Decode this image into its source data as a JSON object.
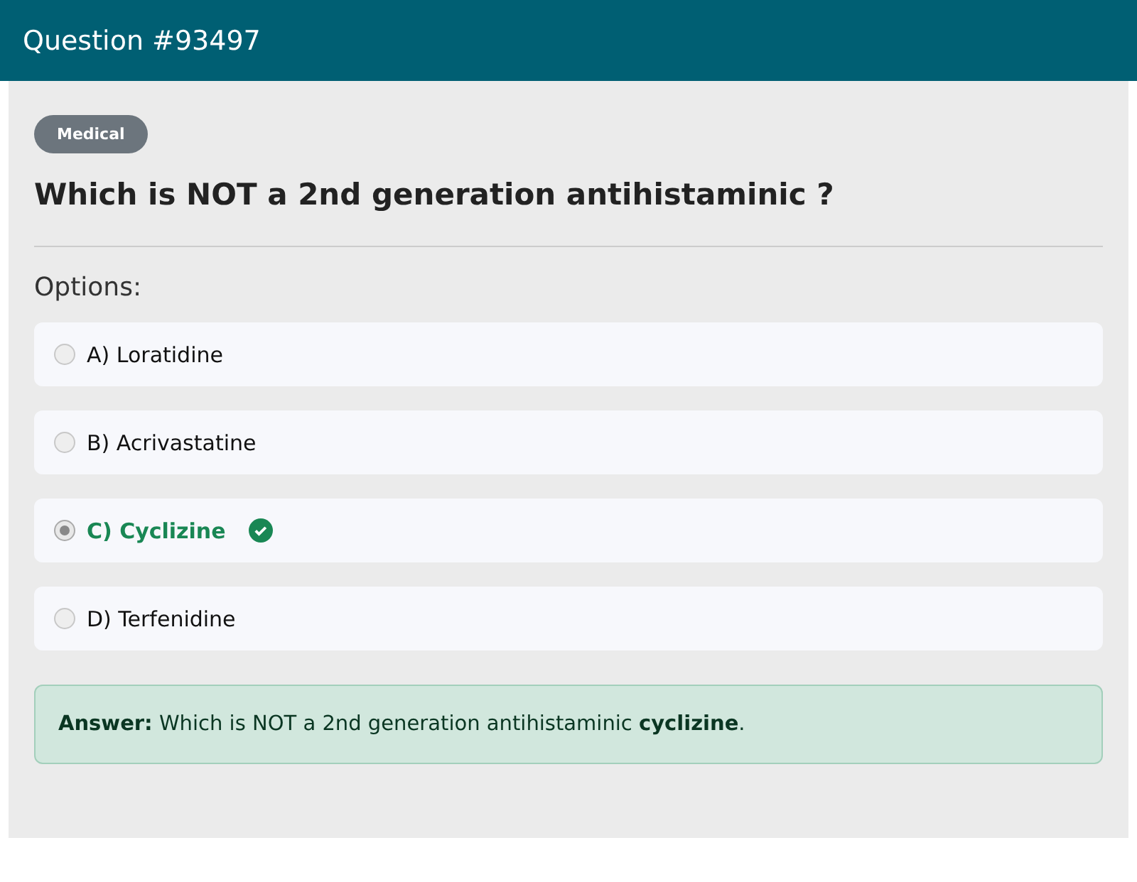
{
  "header": {
    "title": "Question #93497"
  },
  "category": "Medical",
  "question": "Which is NOT a 2nd generation antihistaminic ?",
  "options_label": "Options:",
  "options": [
    {
      "label": "A) Loratidine",
      "selected": false,
      "correct": false
    },
    {
      "label": "B) Acrivastatine",
      "selected": false,
      "correct": false
    },
    {
      "label": "C) Cyclizine",
      "selected": true,
      "correct": true
    },
    {
      "label": "D) Terfenidine",
      "selected": false,
      "correct": false
    }
  ],
  "answer": "**Answer:** Which is NOT a 2nd generation antihistaminic **cyclizine**."
}
